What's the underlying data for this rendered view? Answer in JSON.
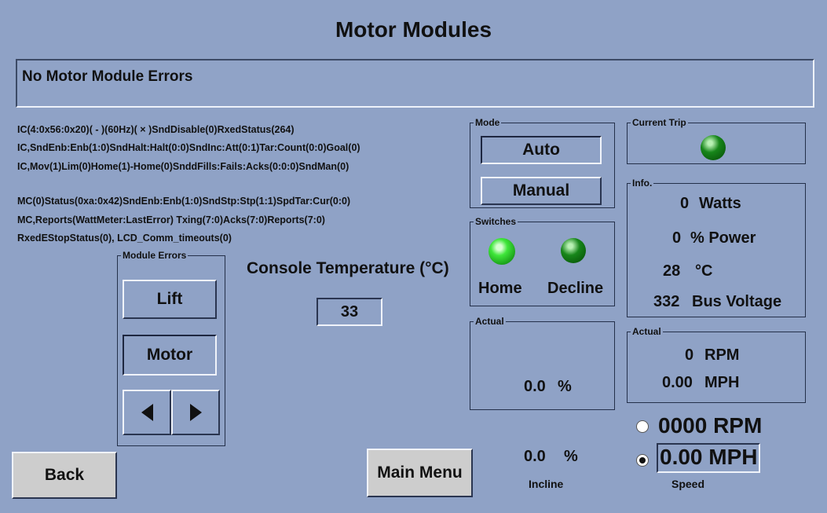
{
  "title": "Motor Modules",
  "error_message": "No Motor Module Errors",
  "diagnostics": [
    "IC(4:0x56:0x20)( - )(60Hz)( × )SndDisable(0)RxedStatus(264)",
    "IC,SndEnb:Enb(1:0)SndHalt:Halt(0:0)SndInc:Att(0:1)Tar:Count(0:0)Goal(0)",
    "IC,Mov(1)Lim(0)Home(1)-Home(0)SnddFills:Fails:Acks(0:0:0)SndMan(0)",
    "MC(0)Status(0xa:0x42)SndEnb:Enb(1:0)SndStp:Stp(1:1)SpdTar:Cur(0:0)",
    "MC,Reports(WattMeter:LastError) Txing(7:0)Acks(7:0)Reports(7:0)",
    "RxedEStopStatus(0), LCD_Comm_timeouts(0)"
  ],
  "module_errors": {
    "legend": "Module Errors",
    "lift_label": "Lift",
    "motor_label": "Motor"
  },
  "console_temperature": {
    "label": "Console Temperature (°C)",
    "value": "33"
  },
  "mode": {
    "legend": "Mode",
    "auto_label": "Auto",
    "manual_label": "Manual",
    "selected": "Auto"
  },
  "switches": {
    "legend": "Switches",
    "home_label": "Home",
    "decline_label": "Decline"
  },
  "incline_actual": {
    "legend": "Actual",
    "value": "0.0",
    "unit": "%"
  },
  "incline_setting": {
    "value": "0.0",
    "unit": "%",
    "label": "Incline"
  },
  "current_trip": {
    "legend": "Current Trip"
  },
  "info": {
    "legend": "Info.",
    "watts_value": "0",
    "watts_unit": "Watts",
    "power_value": "0",
    "power_unit": "% Power",
    "temp_value": "28",
    "temp_unit": "°C",
    "voltage_value": "332",
    "voltage_unit": "Bus Voltage"
  },
  "speed_actual": {
    "legend": "Actual",
    "rpm_value": "0",
    "rpm_unit": "RPM",
    "mph_value": "0.00",
    "mph_unit": "MPH"
  },
  "speed_setting": {
    "rpm_text": "0000 RPM",
    "mph_text": "0.00 MPH",
    "label": "Speed",
    "selected": "MPH"
  },
  "nav": {
    "back_label": "Back",
    "main_menu_label": "Main Menu"
  },
  "colors": {
    "background": "#8fa2c6",
    "led_green": "#2ec82a"
  }
}
